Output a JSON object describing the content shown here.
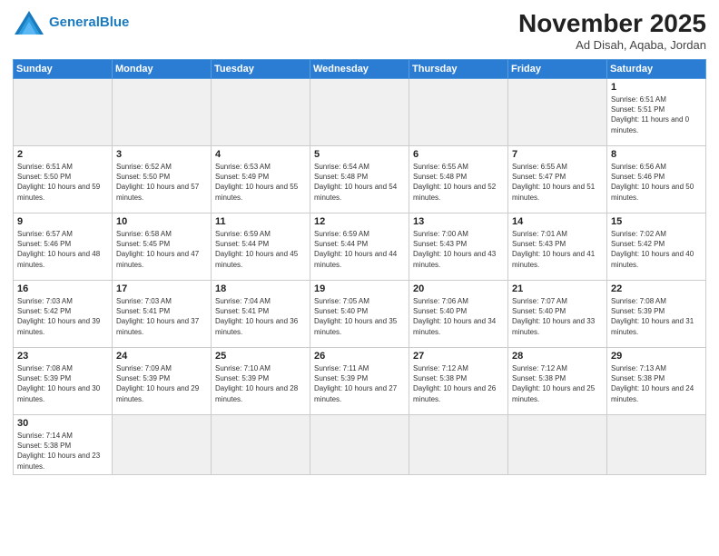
{
  "header": {
    "logo_general": "General",
    "logo_blue": "Blue",
    "month": "November 2025",
    "location": "Ad Disah, Aqaba, Jordan"
  },
  "weekdays": [
    "Sunday",
    "Monday",
    "Tuesday",
    "Wednesday",
    "Thursday",
    "Friday",
    "Saturday"
  ],
  "days": [
    {
      "num": "",
      "info": ""
    },
    {
      "num": "",
      "info": ""
    },
    {
      "num": "",
      "info": ""
    },
    {
      "num": "",
      "info": ""
    },
    {
      "num": "",
      "info": ""
    },
    {
      "num": "",
      "info": ""
    },
    {
      "num": "1",
      "info": "Sunrise: 6:51 AM\nSunset: 5:51 PM\nDaylight: 11 hours and 0 minutes."
    },
    {
      "num": "2",
      "info": "Sunrise: 6:51 AM\nSunset: 5:50 PM\nDaylight: 10 hours and 59 minutes."
    },
    {
      "num": "3",
      "info": "Sunrise: 6:52 AM\nSunset: 5:50 PM\nDaylight: 10 hours and 57 minutes."
    },
    {
      "num": "4",
      "info": "Sunrise: 6:53 AM\nSunset: 5:49 PM\nDaylight: 10 hours and 55 minutes."
    },
    {
      "num": "5",
      "info": "Sunrise: 6:54 AM\nSunset: 5:48 PM\nDaylight: 10 hours and 54 minutes."
    },
    {
      "num": "6",
      "info": "Sunrise: 6:55 AM\nSunset: 5:48 PM\nDaylight: 10 hours and 52 minutes."
    },
    {
      "num": "7",
      "info": "Sunrise: 6:55 AM\nSunset: 5:47 PM\nDaylight: 10 hours and 51 minutes."
    },
    {
      "num": "8",
      "info": "Sunrise: 6:56 AM\nSunset: 5:46 PM\nDaylight: 10 hours and 50 minutes."
    },
    {
      "num": "9",
      "info": "Sunrise: 6:57 AM\nSunset: 5:46 PM\nDaylight: 10 hours and 48 minutes."
    },
    {
      "num": "10",
      "info": "Sunrise: 6:58 AM\nSunset: 5:45 PM\nDaylight: 10 hours and 47 minutes."
    },
    {
      "num": "11",
      "info": "Sunrise: 6:59 AM\nSunset: 5:44 PM\nDaylight: 10 hours and 45 minutes."
    },
    {
      "num": "12",
      "info": "Sunrise: 6:59 AM\nSunset: 5:44 PM\nDaylight: 10 hours and 44 minutes."
    },
    {
      "num": "13",
      "info": "Sunrise: 7:00 AM\nSunset: 5:43 PM\nDaylight: 10 hours and 43 minutes."
    },
    {
      "num": "14",
      "info": "Sunrise: 7:01 AM\nSunset: 5:43 PM\nDaylight: 10 hours and 41 minutes."
    },
    {
      "num": "15",
      "info": "Sunrise: 7:02 AM\nSunset: 5:42 PM\nDaylight: 10 hours and 40 minutes."
    },
    {
      "num": "16",
      "info": "Sunrise: 7:03 AM\nSunset: 5:42 PM\nDaylight: 10 hours and 39 minutes."
    },
    {
      "num": "17",
      "info": "Sunrise: 7:03 AM\nSunset: 5:41 PM\nDaylight: 10 hours and 37 minutes."
    },
    {
      "num": "18",
      "info": "Sunrise: 7:04 AM\nSunset: 5:41 PM\nDaylight: 10 hours and 36 minutes."
    },
    {
      "num": "19",
      "info": "Sunrise: 7:05 AM\nSunset: 5:40 PM\nDaylight: 10 hours and 35 minutes."
    },
    {
      "num": "20",
      "info": "Sunrise: 7:06 AM\nSunset: 5:40 PM\nDaylight: 10 hours and 34 minutes."
    },
    {
      "num": "21",
      "info": "Sunrise: 7:07 AM\nSunset: 5:40 PM\nDaylight: 10 hours and 33 minutes."
    },
    {
      "num": "22",
      "info": "Sunrise: 7:08 AM\nSunset: 5:39 PM\nDaylight: 10 hours and 31 minutes."
    },
    {
      "num": "23",
      "info": "Sunrise: 7:08 AM\nSunset: 5:39 PM\nDaylight: 10 hours and 30 minutes."
    },
    {
      "num": "24",
      "info": "Sunrise: 7:09 AM\nSunset: 5:39 PM\nDaylight: 10 hours and 29 minutes."
    },
    {
      "num": "25",
      "info": "Sunrise: 7:10 AM\nSunset: 5:39 PM\nDaylight: 10 hours and 28 minutes."
    },
    {
      "num": "26",
      "info": "Sunrise: 7:11 AM\nSunset: 5:39 PM\nDaylight: 10 hours and 27 minutes."
    },
    {
      "num": "27",
      "info": "Sunrise: 7:12 AM\nSunset: 5:38 PM\nDaylight: 10 hours and 26 minutes."
    },
    {
      "num": "28",
      "info": "Sunrise: 7:12 AM\nSunset: 5:38 PM\nDaylight: 10 hours and 25 minutes."
    },
    {
      "num": "29",
      "info": "Sunrise: 7:13 AM\nSunset: 5:38 PM\nDaylight: 10 hours and 24 minutes."
    },
    {
      "num": "30",
      "info": "Sunrise: 7:14 AM\nSunset: 5:38 PM\nDaylight: 10 hours and 23 minutes."
    },
    {
      "num": "",
      "info": ""
    },
    {
      "num": "",
      "info": ""
    },
    {
      "num": "",
      "info": ""
    },
    {
      "num": "",
      "info": ""
    },
    {
      "num": "",
      "info": ""
    },
    {
      "num": "",
      "info": ""
    }
  ]
}
